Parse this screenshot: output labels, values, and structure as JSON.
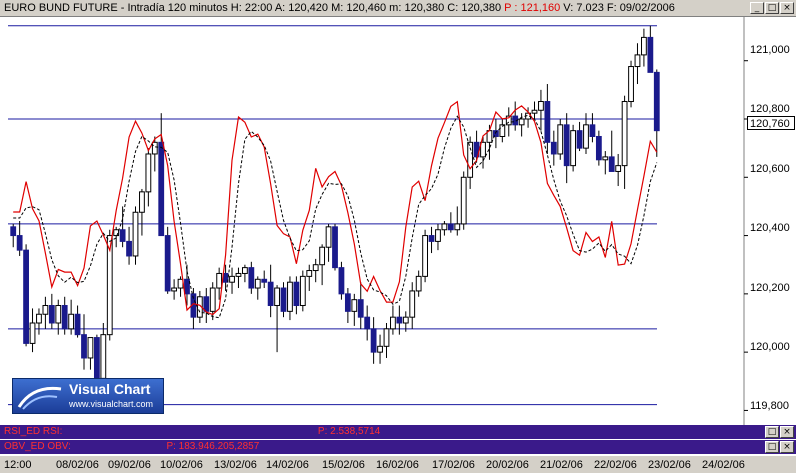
{
  "header": {
    "title": "EURO BUND FUTURE - Intradía 120 minutos  H: 22:00  A: 120,420  M: 120,460  m: 120,380  C: 120,380",
    "p_value": "P : 121,160",
    "tail": "V: 7.023  F: 09/02/2006"
  },
  "window_controls": [
    "_",
    "□",
    "×"
  ],
  "price_tag": "120,760",
  "logo": {
    "name": "Visual Chart",
    "url": "www.visualchart.com"
  },
  "panels": [
    {
      "name": "RSI_ED RSI:",
      "p_value": "P: 2.538,5714"
    },
    {
      "name": "OBV_ED OBV:",
      "p_value": "P: 183.946.205,2857"
    }
  ],
  "colors": {
    "up": "#ffffff",
    "down": "#1a1a8c",
    "rsi_line": "#e00000",
    "obv_line": "#000000",
    "hlines": "#1a1aa0"
  },
  "chart_data": {
    "type": "candlestick",
    "ylim": [
      119.75,
      121.15
    ],
    "y_ticks": [
      "121,000",
      "120,800",
      "120,600",
      "120,400",
      "120,200",
      "120,000",
      "119,800"
    ],
    "y_tick_values": [
      121.0,
      120.8,
      120.6,
      120.4,
      120.2,
      120.0,
      119.8
    ],
    "x_labels": [
      "12:00",
      "08/02/06",
      "09/02/06",
      "10/02/06",
      "13/02/06",
      "14/02/06",
      "15/02/06",
      "16/02/06",
      "17/02/06",
      "20/02/06",
      "21/02/06",
      "22/02/06",
      "23/02/06",
      "24/02/06"
    ],
    "horizontal_lines": [
      121.12,
      120.8,
      120.44,
      120.08,
      119.82
    ],
    "candles": [
      [
        120.43,
        120.44,
        120.36,
        120.4
      ],
      [
        120.4,
        120.45,
        120.33,
        120.35
      ],
      [
        120.35,
        120.37,
        120.02,
        120.03
      ],
      [
        120.03,
        120.15,
        120.0,
        120.1
      ],
      [
        120.1,
        120.15,
        120.06,
        120.13
      ],
      [
        120.13,
        120.19,
        120.08,
        120.16
      ],
      [
        120.16,
        120.2,
        120.08,
        120.1
      ],
      [
        120.1,
        120.18,
        120.06,
        120.16
      ],
      [
        120.16,
        120.19,
        120.06,
        120.08
      ],
      [
        120.08,
        120.18,
        120.06,
        120.13
      ],
      [
        120.13,
        120.16,
        120.05,
        120.06
      ],
      [
        120.06,
        120.13,
        119.94,
        119.98
      ],
      [
        119.98,
        120.05,
        119.94,
        120.05
      ],
      [
        120.05,
        120.06,
        119.88,
        119.91
      ],
      [
        119.91,
        120.1,
        119.88,
        120.06
      ],
      [
        120.06,
        120.42,
        120.04,
        120.4
      ],
      [
        120.4,
        120.43,
        120.36,
        120.42
      ],
      [
        120.42,
        120.5,
        120.36,
        120.38
      ],
      [
        120.38,
        120.43,
        120.3,
        120.33
      ],
      [
        120.33,
        120.5,
        120.3,
        120.48
      ],
      [
        120.48,
        120.56,
        120.4,
        120.55
      ],
      [
        120.55,
        120.7,
        120.5,
        120.68
      ],
      [
        120.68,
        120.74,
        120.62,
        120.72
      ],
      [
        120.72,
        120.82,
        120.4,
        120.4
      ],
      [
        120.4,
        120.43,
        120.2,
        120.21
      ],
      [
        120.21,
        120.25,
        120.18,
        120.22
      ],
      [
        120.22,
        120.26,
        120.19,
        120.25
      ],
      [
        120.25,
        120.3,
        120.16,
        120.2
      ],
      [
        120.2,
        120.22,
        120.08,
        120.12
      ],
      [
        120.12,
        120.21,
        120.1,
        120.19
      ],
      [
        120.19,
        120.22,
        120.1,
        120.14
      ],
      [
        120.14,
        120.24,
        120.11,
        120.22
      ],
      [
        120.22,
        120.29,
        120.18,
        120.27
      ],
      [
        120.27,
        120.3,
        120.21,
        120.24
      ],
      [
        120.24,
        120.29,
        120.2,
        120.26
      ],
      [
        120.26,
        120.29,
        120.22,
        120.27
      ],
      [
        120.27,
        120.3,
        120.24,
        120.29
      ],
      [
        120.29,
        120.31,
        120.2,
        120.22
      ],
      [
        120.22,
        120.26,
        120.18,
        120.25
      ],
      [
        120.25,
        120.28,
        120.22,
        120.24
      ],
      [
        120.24,
        120.3,
        120.12,
        120.16
      ],
      [
        120.16,
        120.23,
        120.0,
        120.22
      ],
      [
        120.22,
        120.24,
        120.12,
        120.14
      ],
      [
        120.14,
        120.26,
        120.11,
        120.24
      ],
      [
        120.24,
        120.26,
        120.13,
        120.16
      ],
      [
        120.16,
        120.28,
        120.14,
        120.26
      ],
      [
        120.26,
        120.3,
        120.21,
        120.28
      ],
      [
        120.28,
        120.32,
        120.24,
        120.3
      ],
      [
        120.3,
        120.37,
        120.23,
        120.36
      ],
      [
        120.36,
        120.44,
        120.31,
        120.43
      ],
      [
        120.43,
        120.44,
        120.28,
        120.29
      ],
      [
        120.29,
        120.31,
        120.18,
        120.2
      ],
      [
        120.2,
        120.22,
        120.1,
        120.14
      ],
      [
        120.14,
        120.2,
        120.09,
        120.18
      ],
      [
        120.18,
        120.24,
        120.08,
        120.12
      ],
      [
        120.12,
        120.16,
        120.04,
        120.08
      ],
      [
        120.08,
        120.12,
        119.96,
        120.0
      ],
      [
        120.0,
        120.06,
        119.96,
        120.02
      ],
      [
        120.02,
        120.1,
        119.98,
        120.08
      ],
      [
        120.08,
        120.16,
        120.06,
        120.12
      ],
      [
        120.12,
        120.16,
        120.06,
        120.1
      ],
      [
        120.1,
        120.14,
        120.07,
        120.12
      ],
      [
        120.12,
        120.24,
        120.08,
        120.21
      ],
      [
        120.21,
        120.28,
        120.19,
        120.26
      ],
      [
        120.26,
        120.42,
        120.24,
        120.4
      ],
      [
        120.4,
        120.43,
        120.34,
        120.38
      ],
      [
        120.38,
        120.44,
        120.35,
        120.42
      ],
      [
        120.42,
        120.45,
        120.4,
        120.44
      ],
      [
        120.44,
        120.48,
        120.41,
        120.42
      ],
      [
        120.42,
        120.5,
        120.4,
        120.44
      ],
      [
        120.44,
        120.62,
        120.42,
        120.6
      ],
      [
        120.6,
        120.74,
        120.56,
        120.72
      ],
      [
        120.72,
        120.76,
        120.65,
        120.67
      ],
      [
        120.67,
        120.74,
        120.63,
        120.72
      ],
      [
        120.72,
        120.78,
        120.66,
        120.76
      ],
      [
        120.76,
        120.8,
        120.7,
        120.74
      ],
      [
        120.74,
        120.8,
        120.72,
        120.78
      ],
      [
        120.78,
        120.84,
        120.74,
        120.81
      ],
      [
        120.81,
        120.86,
        120.76,
        120.78
      ],
      [
        120.78,
        120.82,
        120.74,
        120.8
      ],
      [
        120.8,
        120.84,
        120.77,
        120.82
      ],
      [
        120.82,
        120.86,
        120.8,
        120.83
      ],
      [
        120.83,
        120.9,
        120.76,
        120.86
      ],
      [
        120.86,
        120.92,
        120.68,
        120.72
      ],
      [
        120.72,
        120.76,
        120.64,
        120.68
      ],
      [
        120.68,
        120.8,
        120.66,
        120.78
      ],
      [
        120.78,
        120.82,
        120.58,
        120.64
      ],
      [
        120.64,
        120.78,
        120.62,
        120.76
      ],
      [
        120.76,
        120.79,
        120.69,
        120.7
      ],
      [
        120.7,
        120.82,
        120.68,
        120.78
      ],
      [
        120.78,
        120.82,
        120.72,
        120.74
      ],
      [
        120.74,
        120.76,
        120.64,
        120.66
      ],
      [
        120.66,
        120.69,
        120.61,
        120.67
      ],
      [
        120.67,
        120.76,
        120.62,
        120.62
      ],
      [
        120.62,
        120.68,
        120.57,
        120.64
      ],
      [
        120.64,
        120.88,
        120.56,
        120.86
      ],
      [
        120.86,
        121.0,
        120.84,
        120.98
      ],
      [
        120.98,
        121.06,
        120.92,
        121.02
      ],
      [
        121.02,
        121.11,
        120.98,
        121.08
      ],
      [
        121.08,
        121.12,
        120.96,
        120.96
      ],
      [
        120.96,
        120.97,
        120.67,
        120.76
      ]
    ]
  }
}
